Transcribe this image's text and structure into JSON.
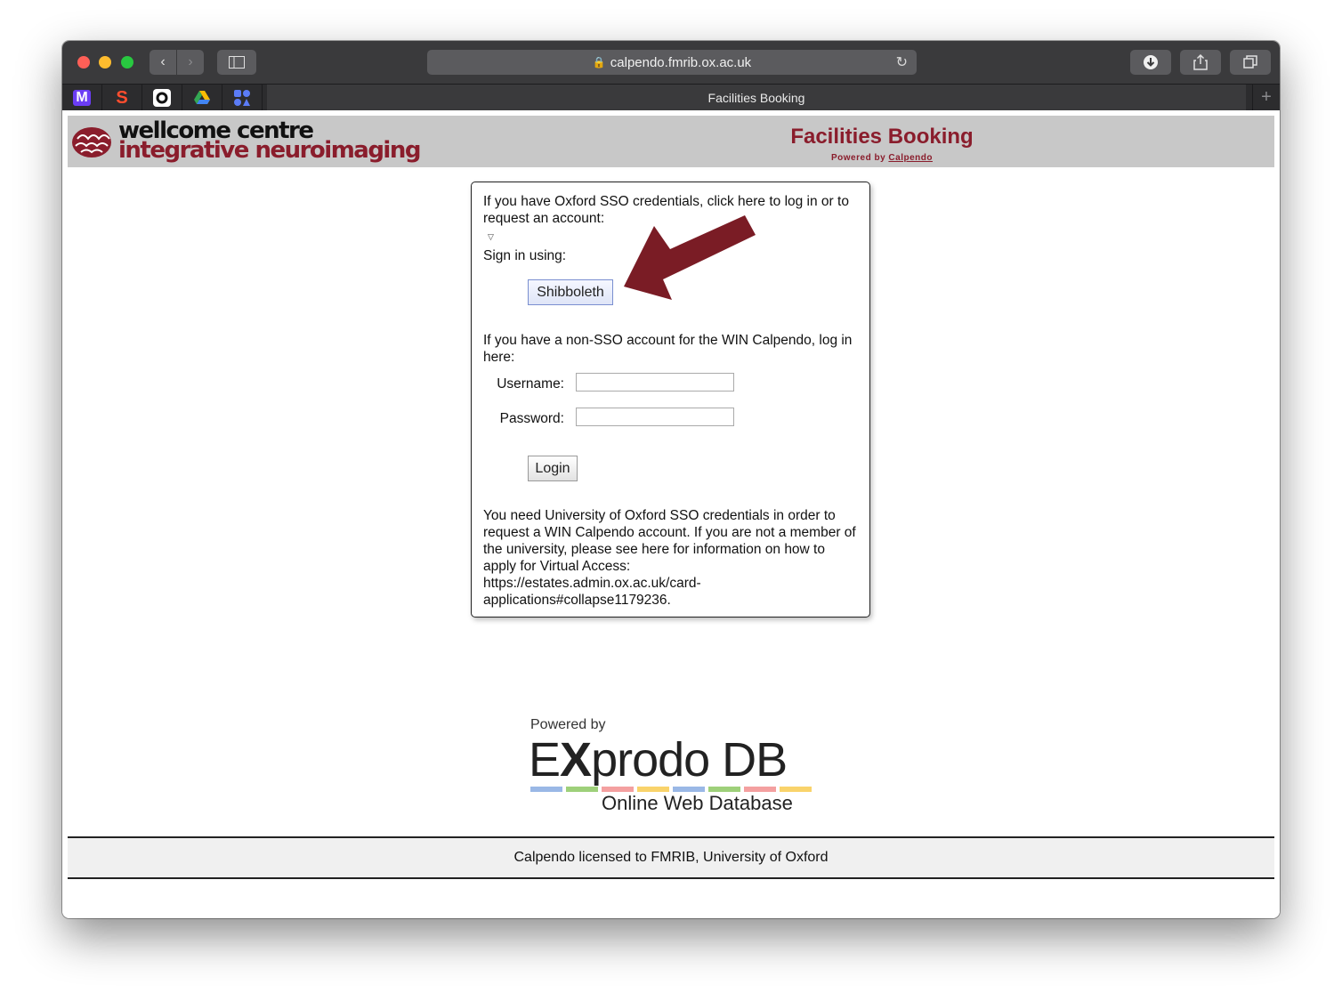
{
  "browser": {
    "url": "calpendo.fmrib.ox.ac.uk",
    "tab_title": "Facilities Booking",
    "favicons": [
      "M",
      "S",
      "github-icon",
      "drive-icon",
      "apps-icon"
    ]
  },
  "header": {
    "logo_line1": "wellcome centre",
    "logo_line2": "integrative neuroimaging",
    "title": "Facilities Booking",
    "powered_prefix": "Powered by",
    "powered_link": "Calpendo"
  },
  "login": {
    "sso_text": "If you have Oxford SSO credentials, click here to log in or to request an account:",
    "sign_in_label": "Sign in using:",
    "shibboleth_button": "Shibboleth",
    "non_sso_text": "If you have a non-SSO account for the WIN Calpendo, log in here:",
    "username_label": "Username:",
    "username_value": "",
    "password_label": "Password:",
    "password_value": "",
    "login_button": "Login",
    "info_text": "You need University of Oxford SSO credentials in order to request a WIN Calpendo account. If you are not a member of the university, please see here for information on how to apply for Virtual Access:",
    "info_url_line1": "https://estates.admin.ox.ac.uk/card-",
    "info_url_line2": "applications#collapse1179236."
  },
  "exprodo": {
    "powered_by": "Powered by",
    "brand_a": "E",
    "brand_b": "X",
    "brand_c": "prodo DB",
    "tagline": "Online Web Database"
  },
  "footer": {
    "text": "Calpendo licensed to FMRIB, University of Oxford"
  },
  "colors": {
    "brand_red": "#8a1d2c",
    "header_bg": "#c8c8c8",
    "titlebar": "#3a3a3c"
  }
}
